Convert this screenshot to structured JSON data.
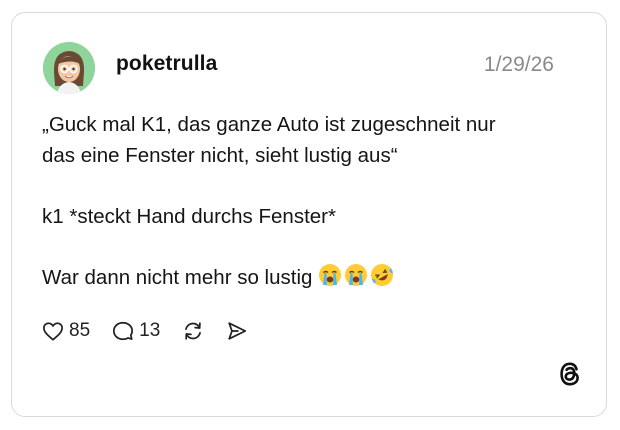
{
  "post": {
    "username": "poketrulla",
    "date": "1/29/26",
    "text": {
      "line1": "„Guck mal K1, das ganze Auto ist zugeschneit nur",
      "line2": "das eine Fenster nicht, sieht lustig aus“",
      "line3": "k1 *steckt Hand durchs Fenster*",
      "line4": "War dann nicht mehr so lustig"
    },
    "emojis": [
      "loudly-crying-face",
      "loudly-crying-face",
      "rolling-on-floor-laughing"
    ]
  },
  "actions": {
    "likes": "85",
    "replies": "13"
  },
  "icons": {
    "like": "heart-icon",
    "reply": "speech-bubble-icon",
    "repost": "repost-icon",
    "share": "send-icon",
    "brand": "threads-logo"
  },
  "colors": {
    "border": "#d9d9d9",
    "avatar_bg": "#8fd49a",
    "date": "#8a8a8a",
    "text": "#151515"
  }
}
